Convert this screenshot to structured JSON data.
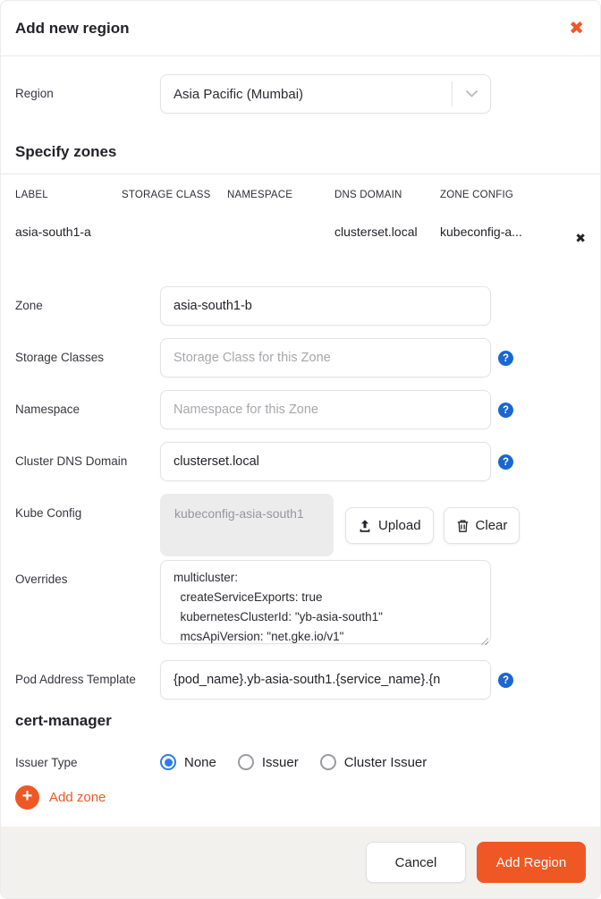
{
  "colors": {
    "accent_orange": "#ef5824",
    "help_blue": "#1a67d0",
    "radio_blue": "#2b7de9",
    "footer_bg": "#f2f1ed"
  },
  "icons": {
    "close": "✖",
    "delete_row": "✖",
    "help": "?",
    "plus": "+"
  },
  "header": {
    "title": "Add new region"
  },
  "region": {
    "label": "Region",
    "value": "Asia Pacific (Mumbai)"
  },
  "zones": {
    "heading": "Specify zones",
    "table": {
      "columns": [
        "LABEL",
        "STORAGE CLASS",
        "NAMESPACE",
        "DNS DOMAIN",
        "ZONE CONFIG"
      ],
      "rows": [
        {
          "label": "asia-south1-a",
          "storage_class": "",
          "namespace": "",
          "dns_domain": "clusterset.local",
          "zone_config": "kubeconfig-a..."
        }
      ]
    }
  },
  "form": {
    "zone": {
      "label": "Zone",
      "value": "asia-south1-b"
    },
    "storage_classes": {
      "label": "Storage Classes",
      "placeholder": "Storage Class for this Zone"
    },
    "namespace": {
      "label": "Namespace",
      "placeholder": "Namespace for this Zone"
    },
    "dns_domain": {
      "label": "Cluster DNS Domain",
      "value": "clusterset.local"
    },
    "kube_config": {
      "label": "Kube Config",
      "file_name": "kubeconfig-asia-south1",
      "upload_label": "Upload",
      "clear_label": "Clear"
    },
    "overrides": {
      "label": "Overrides",
      "value": "multicluster:\n  createServiceExports: true\n  kubernetesClusterId: \"yb-asia-south1\"\n  mcsApiVersion: \"net.gke.io/v1\""
    },
    "pod_address": {
      "label": "Pod Address Template",
      "value": "{pod_name}.yb-asia-south1.{service_name}.{n"
    }
  },
  "cert_manager": {
    "heading": "cert-manager",
    "issuer_type": {
      "label": "Issuer Type",
      "selected_index": 0,
      "options": [
        {
          "label": "None"
        },
        {
          "label": "Issuer"
        },
        {
          "label": "Cluster Issuer"
        }
      ]
    }
  },
  "add_zone": {
    "label": "Add zone"
  },
  "footer": {
    "cancel_label": "Cancel",
    "submit_label": "Add Region"
  }
}
